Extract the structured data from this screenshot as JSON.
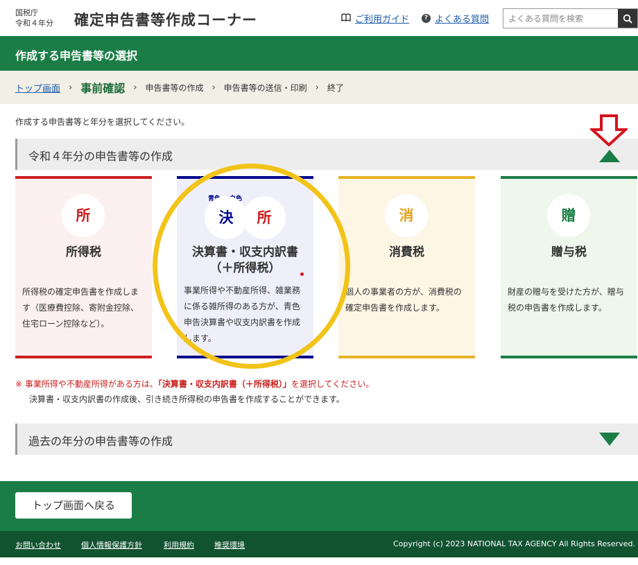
{
  "header": {
    "agency_line1": "国税庁",
    "agency_line2": "令和４年分",
    "site_title": "確定申告書等作成コーナー",
    "guide_link": "ご利用ガイド",
    "faq_link": "よくある質問",
    "faq_icon_glyph": "?",
    "search_placeholder": "よくある質問を検索"
  },
  "page_title": "作成する申告書等の選択",
  "breadcrumb": {
    "top": "トップ画面",
    "current": "事前確認",
    "step3": "申告書等の作成",
    "step4": "申告書等の送信・印刷",
    "step5": "終了",
    "separator": "›"
  },
  "intro_text": "作成する申告書等と年分を選択してください。",
  "section_current": {
    "title": "令和４年分の申告書等の作成"
  },
  "cards": [
    {
      "icon_char": "所",
      "title": "所得税",
      "description": "所得税の確定申告書を作成します（医療費控除、寄附金控除、住宅ローン控除など）。",
      "color": "#cc1f1f"
    },
    {
      "icon_char_blue": "決",
      "icon_char_white": "所",
      "tag_blue": "青色",
      "tag_white": "白色",
      "title_line1": "決算書・収支内訳書",
      "title_line2": "（＋所得税）",
      "description": "事業所得や不動産所得、雑業務に係る雑所得のある方が、青色申告決算書や収支内訳書を作成します。",
      "color": "#00088c"
    },
    {
      "icon_char": "消",
      "title": "消費税",
      "description": "個人の事業者の方が、消費税の確定申告書を作成します。",
      "color": "#e6b526"
    },
    {
      "icon_char": "贈",
      "title": "贈与税",
      "description": "財産の贈与を受けた方が、贈与税の申告書を作成します。",
      "color": "#1b7d46"
    }
  ],
  "note": {
    "mark": "※",
    "line1_pre": "事業所得や不動産所得がある方は、",
    "line1_emph": "「決算書・収支内訳書（＋所得税）」",
    "line1_post": "を選択してください。",
    "line2": "決算書・収支内訳書の作成後、引き続き所得税の申告書を作成することができます。"
  },
  "section_past": {
    "title": "過去の年分の申告書等の作成"
  },
  "back_button": "トップ画面へ戻る",
  "footer": {
    "links": [
      "お問い合わせ",
      "個人情報保護方針",
      "利用規約",
      "推奨環境"
    ],
    "copyright": "Copyright (c) 2023 NATIONAL TAX AGENCY All Rights Reserved."
  },
  "colors": {
    "brand_green": "#1b7d46",
    "dark_green": "#12532f",
    "annotation_ring": "#f2c318",
    "annotation_arrow": "#d8121e"
  }
}
